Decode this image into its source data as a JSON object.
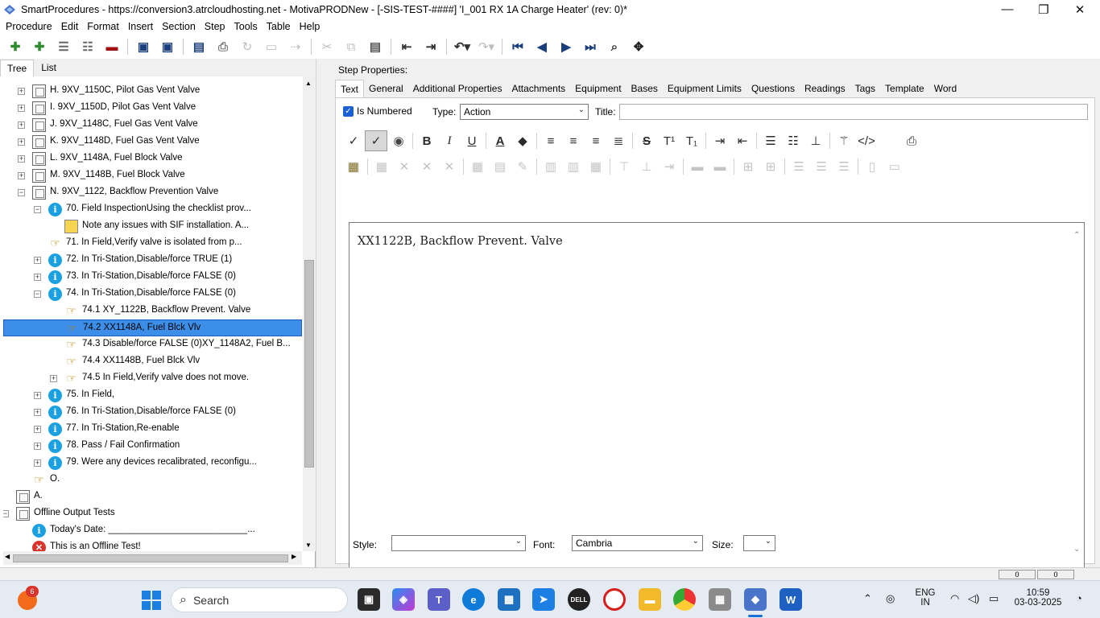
{
  "window": {
    "title": "SmartProcedures - https://conversion3.atrcloudhosting.net - MotivaPRODNew - [-SIS-TEST-####] 'I_001 RX 1A Charge Heater' (rev: 0)*",
    "minimize": "—",
    "maximize": "❐",
    "close": "✕"
  },
  "menu": [
    "Procedure",
    "Edit",
    "Format",
    "Insert",
    "Section",
    "Step",
    "Tools",
    "Table",
    "Help"
  ],
  "left_tabs": [
    "Tree",
    "List"
  ],
  "tree": [
    {
      "label": "H. 9XV_1150C, Pilot Gas Vent Valve",
      "icon": "doc-icon",
      "exp": "+"
    },
    {
      "label": "I. 9XV_1150D, Pilot Gas Vent Valve",
      "icon": "doc-icon",
      "exp": "+"
    },
    {
      "label": "J. 9XV_1148C, Fuel Gas Vent Valve",
      "icon": "doc-icon",
      "exp": "+"
    },
    {
      "label": "K. 9XV_1148D, Fuel Gas Vent Valve",
      "icon": "doc-icon",
      "exp": "+"
    },
    {
      "label": "L. 9XV_1148A, Fuel Block Valve",
      "icon": "doc-icon",
      "exp": "+"
    },
    {
      "label": "M. 9XV_1148B, Fuel Block Valve",
      "icon": "doc-icon",
      "exp": "+"
    },
    {
      "label": "N. 9XV_1122, Backflow Prevention Valve",
      "icon": "doc-icon",
      "exp": "−"
    },
    {
      "label": "70. Field InspectionUsing the checklist prov...",
      "icon": "info-icon",
      "exp": "−"
    },
    {
      "label": "Note any issues with SIF installation. A...",
      "icon": "note-icon",
      "exp": ""
    },
    {
      "label": "71. In Field,Verify valve is isolated from p...",
      "icon": "hand-icon",
      "exp": ""
    },
    {
      "label": "72. In Tri-Station,Disable/force TRUE (1)",
      "icon": "info-icon",
      "exp": "+"
    },
    {
      "label": "73. In Tri-Station,Disable/force FALSE (0)",
      "icon": "info-icon",
      "exp": "+"
    },
    {
      "label": "74. In Tri-Station,Disable/force FALSE (0)",
      "icon": "info-icon",
      "exp": "−"
    },
    {
      "label": "74.1 XY_1122B, Backflow Prevent. Valve",
      "icon": "hand-icon",
      "exp": ""
    },
    {
      "label": "74.2 XX1148A, Fuel Blck Vlv",
      "icon": "hand-icon",
      "exp": "",
      "selected": true
    },
    {
      "label": "74.3 Disable/force FALSE (0)XY_1148A2, Fuel B...",
      "icon": "hand-icon",
      "exp": ""
    },
    {
      "label": "74.4 XX1148B, Fuel Blck Vlv",
      "icon": "hand-icon",
      "exp": ""
    },
    {
      "label": "74.5 In Field,Verify valve does not move.",
      "icon": "hand-icon",
      "exp": "+"
    },
    {
      "label": "75. In Field,",
      "icon": "info-icon",
      "exp": "+"
    },
    {
      "label": "76. In Tri-Station,Disable/force FALSE (0)",
      "icon": "info-icon",
      "exp": "+"
    },
    {
      "label": "77. In Tri-Station,Re-enable",
      "icon": "info-icon",
      "exp": "+"
    },
    {
      "label": "78. Pass / Fail Confirmation",
      "icon": "info-icon",
      "exp": "+"
    },
    {
      "label": "79. Were any devices recalibrated, reconfigu...",
      "icon": "info-icon",
      "exp": "+"
    },
    {
      "label": "O.",
      "icon": "hand-icon",
      "exp": ""
    },
    {
      "label": "A.",
      "icon": "doc-icon",
      "exp": ""
    },
    {
      "label": "Offline Output Tests",
      "icon": "doc-icon",
      "exp": "−"
    },
    {
      "label": "Today's Date: ___________________________...",
      "icon": "info-icon",
      "exp": ""
    },
    {
      "label": "This is an Offline Test!",
      "icon": "error-icon",
      "exp": ""
    }
  ],
  "step_properties": {
    "heading": "Step Properties:",
    "tabs": [
      "Text",
      "General",
      "Additional Properties",
      "Attachments",
      "Equipment",
      "Bases",
      "Equipment Limits",
      "Questions",
      "Readings",
      "Tags",
      "Template",
      "Word"
    ],
    "is_numbered_label": "Is Numbered",
    "is_numbered": true,
    "type_label": "Type:",
    "type_value": "Action",
    "title_label": "Title:",
    "title_value": "",
    "editor_text": "XX1122B, Backflow Prevent. Valve",
    "style_label": "Style:",
    "style_value": "",
    "font_label": "Font:",
    "font_value": "Cambria",
    "size_label": "Size:",
    "size_value": ""
  },
  "status": {
    "a": "0",
    "b": "0"
  },
  "taskbar": {
    "search_placeholder": "Search",
    "notification_count": "6",
    "lang_line1": "ENG",
    "lang_line2": "IN",
    "time": "10:59",
    "date": "03-03-2025"
  }
}
